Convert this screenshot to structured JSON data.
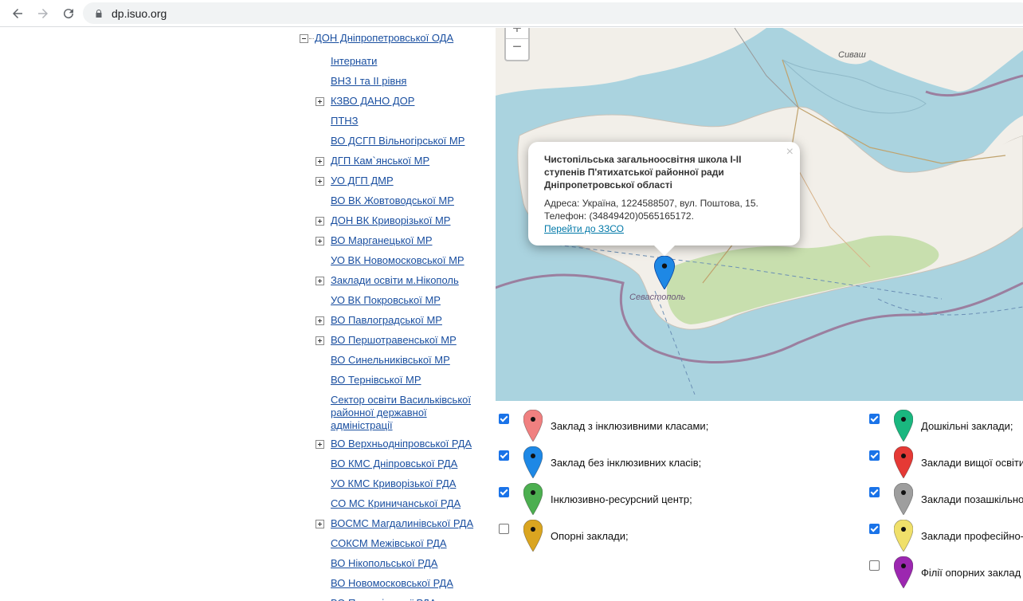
{
  "browser": {
    "url": "dp.isuo.org"
  },
  "tree": {
    "root_label": "ДОН Дніпропетровської ОДА",
    "items": [
      {
        "label": "Інтернати",
        "expandable": false
      },
      {
        "label": "ВНЗ І та ІІ рівня",
        "expandable": false
      },
      {
        "label": "КЗВО ДАНО ДОР",
        "expandable": true
      },
      {
        "label": "ПТНЗ",
        "expandable": false
      },
      {
        "label": "ВО ДСГП Вільногірської МР",
        "expandable": false
      },
      {
        "label": "ДГП Кам`янської МР",
        "expandable": true
      },
      {
        "label": "УО ДГП ДМР",
        "expandable": true
      },
      {
        "label": "ВО ВК Жовтоводської МР",
        "expandable": false
      },
      {
        "label": "ДОН ВК Криворізької МР",
        "expandable": true
      },
      {
        "label": "ВО Марганецької МР",
        "expandable": true
      },
      {
        "label": "УО ВК Новомосковської МР",
        "expandable": false
      },
      {
        "label": "Заклади освіти м.Нікополь",
        "expandable": true
      },
      {
        "label": "УО ВК Покровської МР",
        "expandable": false
      },
      {
        "label": "ВО Павлоградської МР",
        "expandable": true
      },
      {
        "label": "ВО Першотравенської МР",
        "expandable": true
      },
      {
        "label": "ВО Синельниківської МР",
        "expandable": false
      },
      {
        "label": "ВО Тернівської МР",
        "expandable": false
      },
      {
        "label": "Сектор освіти Васильківської районної державної адміністрації",
        "expandable": false
      },
      {
        "label": "ВО Верхньодніпровської РДА",
        "expandable": true
      },
      {
        "label": "ВО КМС Дніпровської РДА",
        "expandable": false
      },
      {
        "label": "УО КМС Криворізької РДА",
        "expandable": false
      },
      {
        "label": "СО МС Криничанської РДА",
        "expandable": false
      },
      {
        "label": "ВОСМС Магдалинівської РДА",
        "expandable": true
      },
      {
        "label": "СОКСМ Межівської РДА",
        "expandable": false
      },
      {
        "label": "ВО Нікопольської РДА",
        "expandable": false
      },
      {
        "label": "ВО Новомосковської РДА",
        "expandable": false
      },
      {
        "label": "ВО Петриківської РДА",
        "expandable": false
      }
    ]
  },
  "map": {
    "zoom_in": "+",
    "zoom_out": "−",
    "labels": {
      "sivash": "Сиваш",
      "sevastopol": "Севастополь"
    },
    "popup": {
      "close": "×",
      "title": "Чистопільська загальноосвітня школа І-ІІ ступенів П'ятихатської районної ради Дніпропетровської області",
      "address": "Адреса: Україна, 1224588507, вул. Поштова, 15.",
      "phone": "Телефон: (34849420)0565165172.",
      "link": "Перейти до ЗЗСО"
    },
    "marker_color": "#1e88e5"
  },
  "legend": {
    "left": [
      {
        "label": "Заклад з інклюзивними класами;",
        "checked": true,
        "color": "#f08080"
      },
      {
        "label": "Заклад без інклюзивних класів;",
        "checked": true,
        "color": "#1e88e5"
      },
      {
        "label": "Інклюзивно-ресурсний центр;",
        "checked": true,
        "color": "#4caf50"
      },
      {
        "label": "Опорні заклади;",
        "checked": false,
        "color": "#daa520"
      }
    ],
    "right": [
      {
        "label": "Дошкільні заклади;",
        "checked": true,
        "color": "#1ab77f"
      },
      {
        "label": "Заклади вищої освіти",
        "checked": true,
        "color": "#e53935"
      },
      {
        "label": "Заклади позашкільно",
        "checked": true,
        "color": "#9e9e9e"
      },
      {
        "label": "Заклади професійно-",
        "checked": true,
        "color": "#f0e06a"
      },
      {
        "label": "Філії опорних заклад",
        "checked": false,
        "color": "#9c27b0"
      }
    ]
  }
}
